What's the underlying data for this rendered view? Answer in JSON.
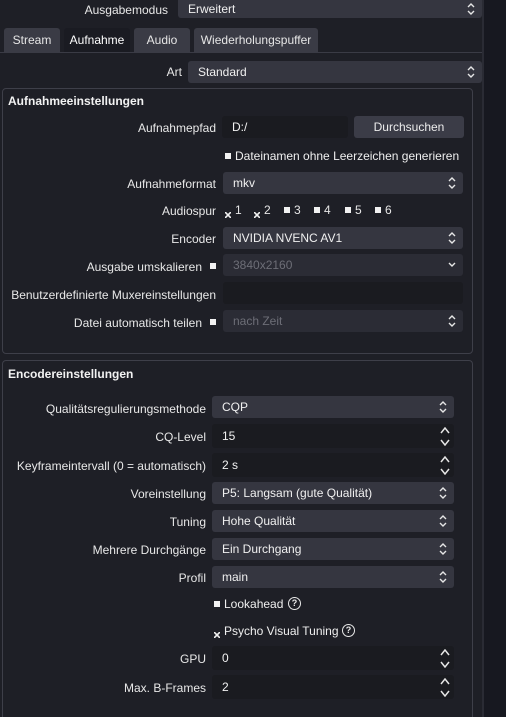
{
  "top": {
    "output_mode_label": "Ausgabemodus",
    "output_mode_value": "Erweitert"
  },
  "tabs": [
    {
      "label": "Stream"
    },
    {
      "label": "Aufnahme"
    },
    {
      "label": "Audio"
    },
    {
      "label": "Wiederholungspuffer"
    }
  ],
  "type": {
    "label": "Art",
    "value": "Standard"
  },
  "recording": {
    "title": "Aufnahmeeinstellungen",
    "path_label": "Aufnahmepfad",
    "path_value": "D:/",
    "browse_label": "Durchsuchen",
    "no_spaces_label": "Dateinamen ohne Leerzeichen generieren",
    "format_label": "Aufnahmeformat",
    "format_value": "mkv",
    "audio_track_label": "Audiospur",
    "tracks": [
      "1",
      "2",
      "3",
      "4",
      "5",
      "6"
    ],
    "encoder_label": "Encoder",
    "encoder_value": "NVIDIA NVENC AV1",
    "rescale_label": "Ausgabe umskalieren",
    "rescale_value": "3840x2160",
    "mux_label": "Benutzerdefinierte Muxereinstellungen",
    "mux_value": "",
    "split_label": "Datei automatisch teilen",
    "split_value": "nach Zeit"
  },
  "encoder": {
    "title": "Encodereinstellungen",
    "rate_control_label": "Qualitätsregulierungsmethode",
    "rate_control_value": "CQP",
    "cq_label": "CQ-Level",
    "cq_value": "15",
    "keyframe_label": "Keyframeintervall (0 = automatisch)",
    "keyframe_value": "2 s",
    "preset_label": "Voreinstellung",
    "preset_value": "P5: Langsam (gute Qualität)",
    "tuning_label": "Tuning",
    "tuning_value": "Hohe Qualität",
    "multipass_label": "Mehrere Durchgänge",
    "multipass_value": "Ein Durchgang",
    "profile_label": "Profil",
    "profile_value": "main",
    "lookahead_label": "Lookahead",
    "psycho_label": "Psycho Visual Tuning",
    "gpu_label": "GPU",
    "gpu_value": "0",
    "bframes_label": "Max. B-Frames",
    "bframes_value": "2",
    "help_glyph": "?"
  },
  "colors": {
    "background": "#1e1f26",
    "combo": "#353640",
    "field": "#1a1b20",
    "border": "#3e3f49"
  }
}
